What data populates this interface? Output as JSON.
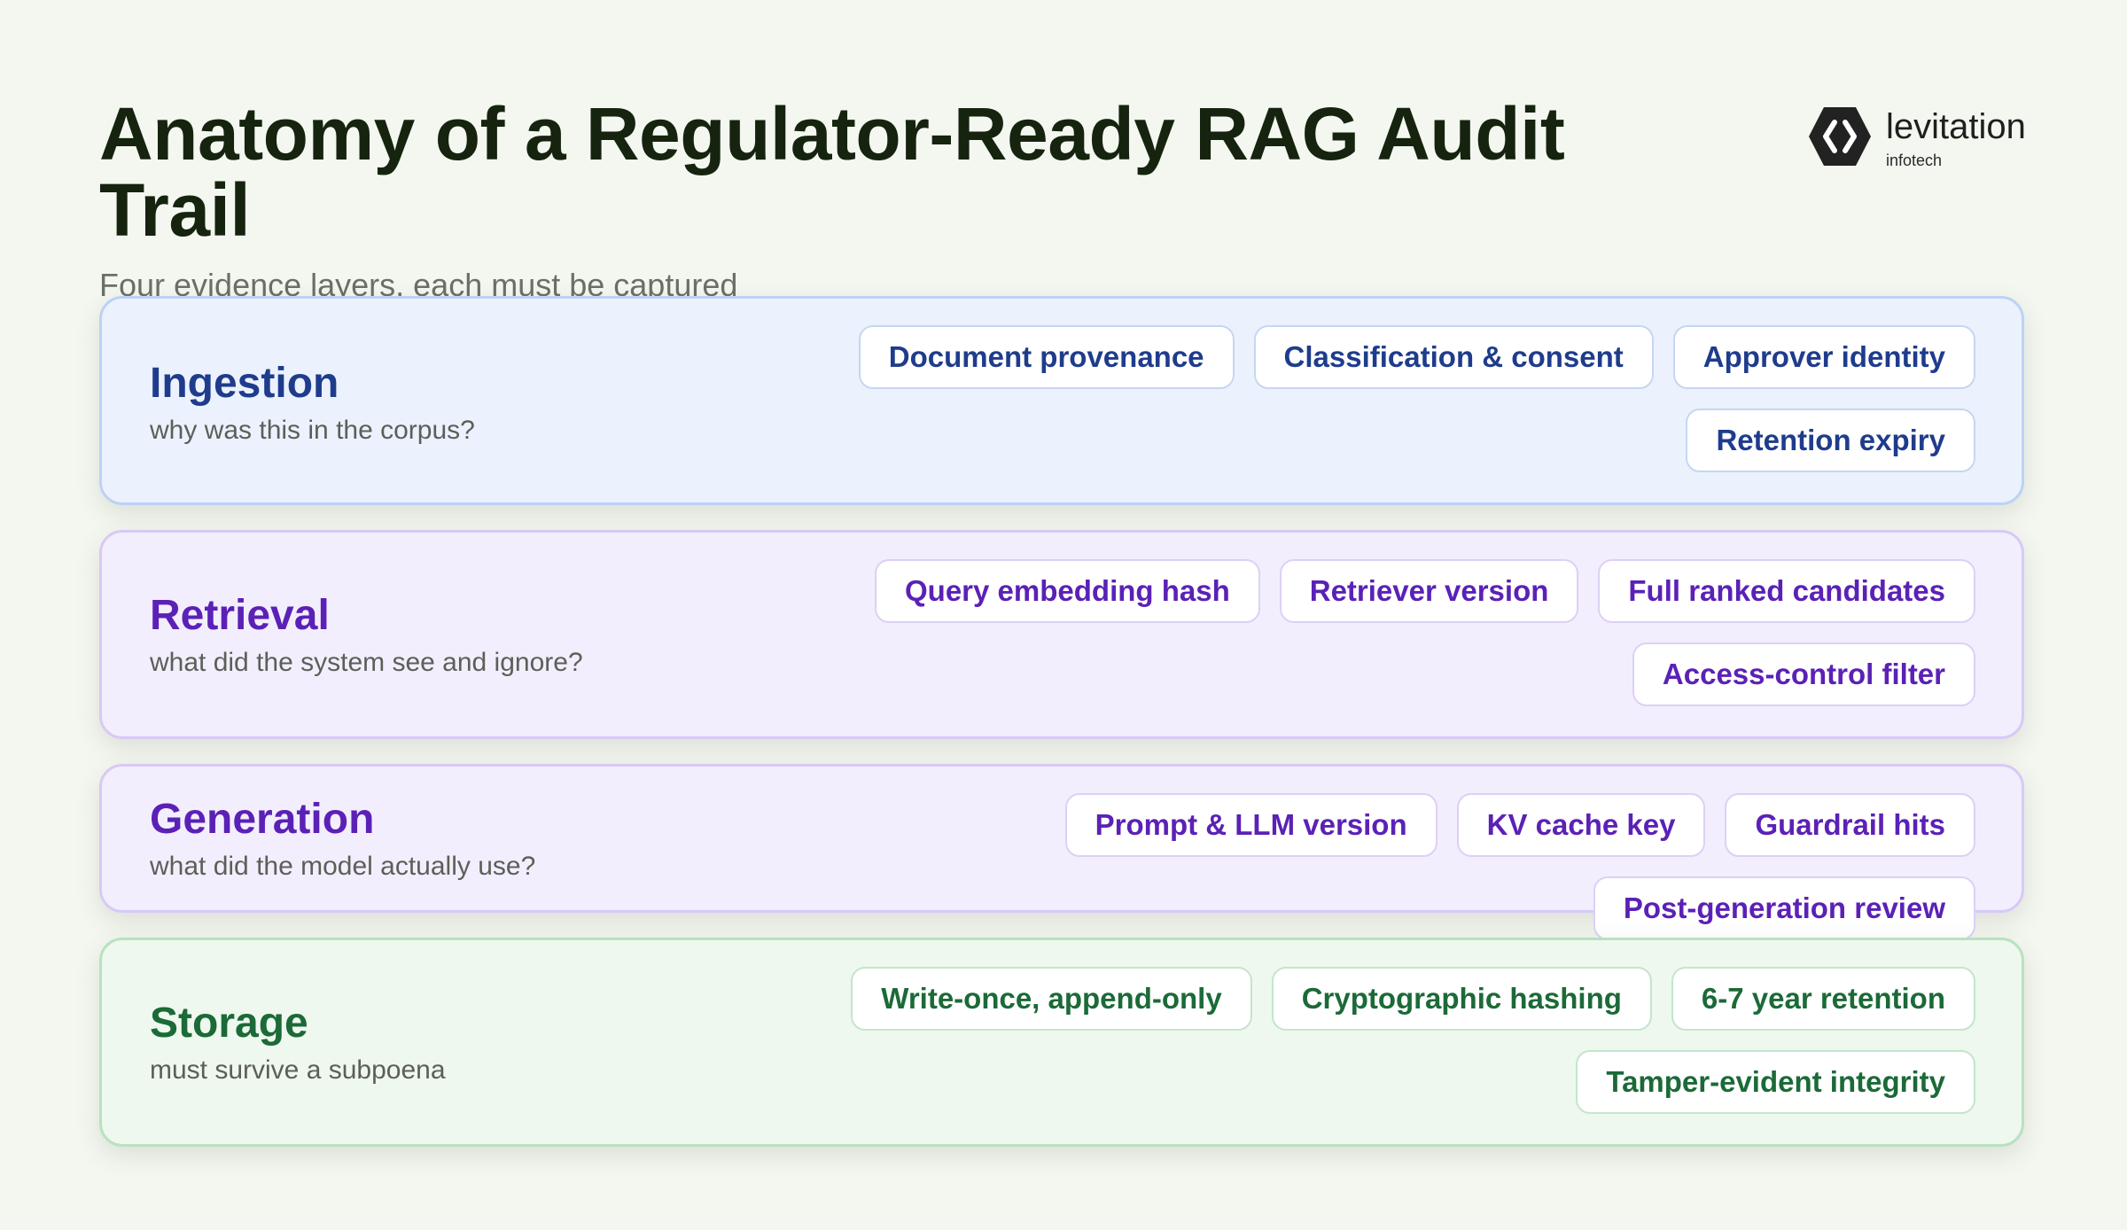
{
  "title": "Anatomy of a Regulator-Ready RAG Audit Trail",
  "subtitle": "Four evidence layers, each must be captured",
  "logo": {
    "name": "levitation",
    "sub": "infotech",
    "colors": {
      "mark": "#222222",
      "glyph": "#ffffff"
    }
  },
  "layers": [
    {
      "name": "Ingestion",
      "question": "why was this in the corpus?",
      "items": [
        "Document provenance",
        "Classification & consent",
        "Approver identity",
        "Retention expiry"
      ]
    },
    {
      "name": "Retrieval",
      "question": "what did the system see and ignore?",
      "items": [
        "Query embedding hash",
        "Retriever version",
        "Full ranked candidates",
        "Access-control filter"
      ]
    },
    {
      "name": "Generation",
      "question": "what did the model actually use?",
      "items": [
        "Prompt & LLM version",
        "KV cache key",
        "Guardrail hits",
        "Post-generation review"
      ]
    },
    {
      "name": "Storage",
      "question": "must survive a subpoena",
      "items": [
        "Write-once, append-only",
        "Cryptographic hashing",
        "6-7 year retention",
        "Tamper-evident integrity"
      ]
    }
  ],
  "colors": {
    "background": "#f4f7f0",
    "ingestion_accent": "#1f3c8c",
    "retrieval_accent": "#5b21b6",
    "generation_accent": "#5b21b6",
    "storage_accent": "#1b6a37"
  }
}
